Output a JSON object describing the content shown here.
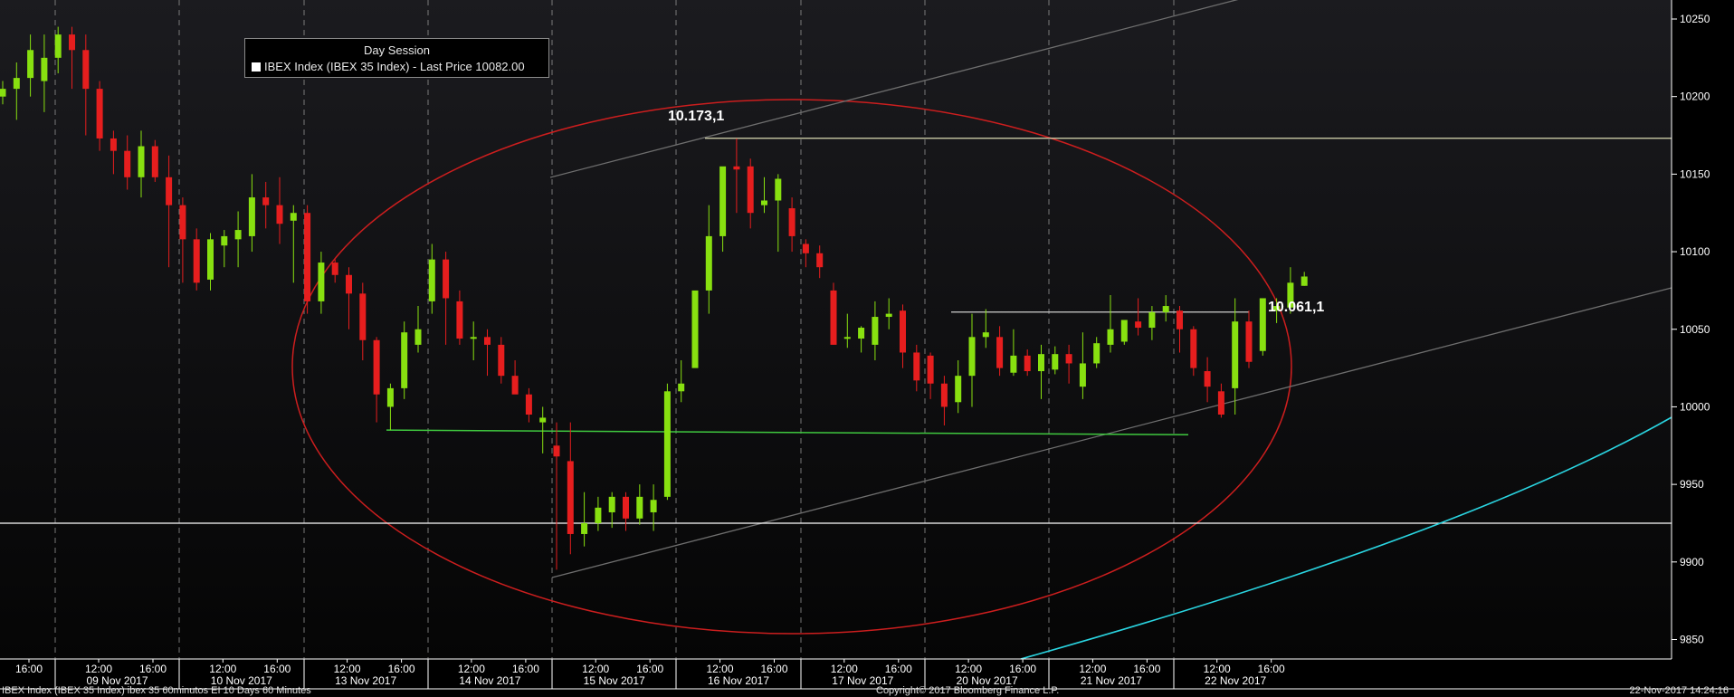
{
  "chart_data": {
    "type": "candlestick",
    "legend": {
      "title": "Day Session",
      "entry": "IBEX Index (IBEX 35 Index) - Last Price 10082.00",
      "swatch_color": "#ffffff"
    },
    "y_axis": {
      "position": "right",
      "ylim": [
        9835,
        10262
      ],
      "ticks": [
        9850,
        9900,
        9950,
        10000,
        10050,
        10100,
        10150,
        10200,
        10250
      ]
    },
    "x_axis": {
      "time_labels": [
        "16:00",
        "12:00",
        "16:00",
        "12:00",
        "16:00",
        "12:00",
        "16:00",
        "12:00",
        "16:00",
        "12:00",
        "16:00",
        "12:00",
        "16:00",
        "12:00",
        "16:00",
        "12:00",
        "16:00",
        "12:00",
        "16:00",
        "12:00",
        "16:00"
      ],
      "date_labels": [
        "09 Nov 2017",
        "10 Nov 2017",
        "13 Nov 2017",
        "14 Nov 2017",
        "15 Nov 2017",
        "16 Nov 2017",
        "17 Nov 2017",
        "20 Nov 2017",
        "21 Nov 2017",
        "22 Nov 2017"
      ]
    },
    "colors": {
      "up": "#88e010",
      "down": "#e61e1e",
      "background_top": "#1b1b1f",
      "background_bottom": "#050505",
      "ellipse": "#cc1e1e",
      "support": "#3fc83f",
      "resistance": "#dcdcb4",
      "channel": "#6e6e6e",
      "curve": "#2ad4e0",
      "level": "#ffffff"
    },
    "candles": [
      [
        10200,
        10210,
        10195,
        10205
      ],
      [
        10205,
        10222,
        10185,
        10212
      ],
      [
        10212,
        10240,
        10200,
        10230
      ],
      [
        10210,
        10240,
        10190,
        10225
      ],
      [
        10225,
        10245,
        10215,
        10240
      ],
      [
        10240,
        10245,
        10205,
        10230
      ],
      [
        10230,
        10240,
        10175,
        10205
      ],
      [
        10205,
        10210,
        10165,
        10173
      ],
      [
        10173,
        10178,
        10150,
        10165
      ],
      [
        10165,
        10175,
        10140,
        10148
      ],
      [
        10148,
        10178,
        10135,
        10168
      ],
      [
        10168,
        10172,
        10145,
        10148
      ],
      [
        10148,
        10162,
        10090,
        10130
      ],
      [
        10130,
        10135,
        10080,
        10108
      ],
      [
        10108,
        10115,
        10075,
        10080
      ],
      [
        10082,
        10112,
        10075,
        10108
      ],
      [
        10104,
        10114,
        10090,
        10110
      ],
      [
        10108,
        10126,
        10090,
        10114
      ],
      [
        10110,
        10150,
        10100,
        10135
      ],
      [
        10135,
        10145,
        10115,
        10130
      ],
      [
        10130,
        10148,
        10105,
        10118
      ],
      [
        10120,
        10130,
        10080,
        10125
      ],
      [
        10125,
        10130,
        10060,
        10068
      ],
      [
        10068,
        10100,
        10060,
        10093
      ],
      [
        10093,
        10095,
        10080,
        10085
      ],
      [
        10085,
        10090,
        10050,
        10073
      ],
      [
        10073,
        10080,
        10030,
        10043
      ],
      [
        10043,
        10045,
        9990,
        10008
      ],
      [
        10000,
        10015,
        9985,
        10012
      ],
      [
        10012,
        10055,
        10005,
        10048
      ],
      [
        10040,
        10065,
        10035,
        10050
      ],
      [
        10068,
        10105,
        10060,
        10095
      ],
      [
        10095,
        10100,
        10040,
        10070
      ],
      [
        10068,
        10075,
        10040,
        10044
      ],
      [
        10044,
        10055,
        10030,
        10045
      ],
      [
        10045,
        10050,
        10020,
        10040
      ],
      [
        10040,
        10045,
        10015,
        10020
      ],
      [
        10020,
        10030,
        10010,
        10008
      ],
      [
        10008,
        10012,
        9990,
        9995
      ],
      [
        9990,
        10000,
        9970,
        9993
      ],
      [
        9975,
        9990,
        9895,
        9968
      ],
      [
        9965,
        9990,
        9905,
        9918
      ],
      [
        9918,
        9945,
        9910,
        9925
      ],
      [
        9925,
        9942,
        9920,
        9935
      ],
      [
        9932,
        9945,
        9922,
        9942
      ],
      [
        9942,
        9945,
        9920,
        9928
      ],
      [
        9928,
        9950,
        9924,
        9942
      ],
      [
        9932,
        9950,
        9920,
        9940
      ],
      [
        9942,
        10015,
        9940,
        10010
      ],
      [
        10010,
        10030,
        10003,
        10015
      ],
      [
        10025,
        10050,
        10045,
        10075
      ],
      [
        10075,
        10130,
        10060,
        10110
      ],
      [
        10110,
        10150,
        10100,
        10155
      ],
      [
        10155,
        10173,
        10125,
        10153
      ],
      [
        10155,
        10160,
        10115,
        10125
      ],
      [
        10130,
        10148,
        10125,
        10133
      ],
      [
        10133,
        10150,
        10100,
        10147
      ],
      [
        10128,
        10135,
        10100,
        10110
      ],
      [
        10105,
        10108,
        10090,
        10099
      ],
      [
        10099,
        10104,
        10083,
        10090
      ],
      [
        10075,
        10080,
        10040,
        10040
      ],
      [
        10045,
        10060,
        10038,
        10045
      ],
      [
        10044,
        10052,
        10035,
        10051
      ],
      [
        10040,
        10068,
        10030,
        10058
      ],
      [
        10058,
        10070,
        10050,
        10060
      ],
      [
        10062,
        10066,
        10025,
        10035
      ],
      [
        10035,
        10040,
        10010,
        10017
      ],
      [
        10033,
        10035,
        10005,
        10015
      ],
      [
        10015,
        10020,
        9988,
        10000
      ],
      [
        10003,
        10030,
        9996,
        10020
      ],
      [
        10020,
        10060,
        10000,
        10045
      ],
      [
        10045,
        10063,
        10038,
        10048
      ],
      [
        10045,
        10052,
        10020,
        10025
      ],
      [
        10022,
        10050,
        10020,
        10033
      ],
      [
        10033,
        10037,
        10020,
        10023
      ],
      [
        10023,
        10040,
        10005,
        10034
      ],
      [
        10024,
        10039,
        10021,
        10034
      ],
      [
        10034,
        10040,
        10015,
        10028
      ],
      [
        10013,
        10048,
        10005,
        10028
      ],
      [
        10028,
        10045,
        10025,
        10041
      ],
      [
        10040,
        10072,
        10035,
        10050
      ],
      [
        10042,
        10055,
        10040,
        10056
      ],
      [
        10055,
        10070,
        10046,
        10051
      ],
      [
        10051,
        10065,
        10043,
        10061
      ],
      [
        10061,
        10072,
        10055,
        10065
      ],
      [
        10062,
        10065,
        10035,
        10050
      ],
      [
        10050,
        10052,
        10020,
        10025
      ],
      [
        10023,
        10032,
        10003,
        10013
      ],
      [
        10010,
        10015,
        9993,
        9995
      ],
      [
        10012,
        10070,
        9995,
        10055
      ],
      [
        10055,
        10062,
        10025,
        10029
      ],
      [
        10036,
        10070,
        10033,
        10070
      ],
      [
        10062,
        10070,
        10054,
        10065
      ],
      [
        10064,
        10090,
        10060,
        10080
      ],
      [
        10078,
        10087,
        10078,
        10084
      ]
    ],
    "annotations": {
      "high_label": "10.173,1",
      "last_label": "10.061,1"
    }
  },
  "footer": {
    "left": "IBEX Index (IBEX 35 Index) ibex 35 60minutos EI 10 Days 60 Minutes",
    "center": "Copyright© 2017 Bloomberg Finance L.P.",
    "right": "22-Nov-2017 14:24:16"
  }
}
